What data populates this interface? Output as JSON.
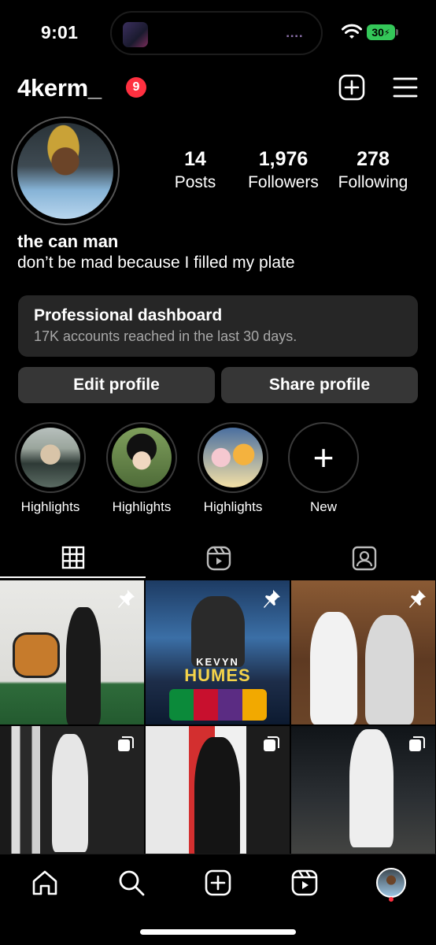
{
  "status_bar": {
    "time": "9:01",
    "battery": "30"
  },
  "header": {
    "username": "4kerm_",
    "notification_count": "9"
  },
  "profile": {
    "stats": [
      {
        "value": "14",
        "label": "Posts"
      },
      {
        "value": "1,976",
        "label": "Followers"
      },
      {
        "value": "278",
        "label": "Following"
      }
    ],
    "display_name": "the can man",
    "bio": "don’t be mad because I filled my plate"
  },
  "dashboard": {
    "title": "Professional dashboard",
    "subtitle": "17K accounts reached in the last 30 days."
  },
  "buttons": {
    "edit": "Edit profile",
    "share": "Share profile"
  },
  "highlights": [
    {
      "label": "Highlights"
    },
    {
      "label": "Highlights"
    },
    {
      "label": "Highlights"
    },
    {
      "label": "New"
    }
  ],
  "posts": [
    {
      "pinned": true,
      "multi": false
    },
    {
      "pinned": true,
      "multi": false,
      "overlay_small": "KEVYN",
      "overlay_large": "HUMES"
    },
    {
      "pinned": true,
      "multi": false
    },
    {
      "pinned": false,
      "multi": true
    },
    {
      "pinned": false,
      "multi": true
    },
    {
      "pinned": false,
      "multi": true
    }
  ],
  "icons": {
    "add_post": "plus-square-icon",
    "menu": "hamburger-menu-icon",
    "grid_tab": "grid-icon",
    "reels_tab": "reels-icon",
    "tagged_tab": "tagged-icon",
    "nav": [
      "home-icon",
      "search-icon",
      "create-icon",
      "reels-icon",
      "profile-avatar"
    ]
  },
  "colors": {
    "badge_red": "#ff3040",
    "battery_green": "#34c759",
    "card_bg": "#262626",
    "button_bg": "#363636"
  }
}
